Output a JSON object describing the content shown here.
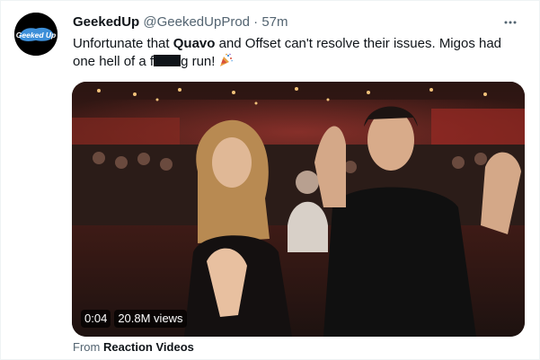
{
  "tweet": {
    "display_name": "GeekedUp",
    "handle": "@GeekedUpProd",
    "separator": "·",
    "time": "57m",
    "text_part1": "Unfortunate that ",
    "text_bold": "Quavo",
    "text_part2": " and Offset can't resolve their issues. Migos had one hell of a f",
    "text_part3": "g run!",
    "emoji": "party-popper"
  },
  "avatar": {
    "logo_text": "Geeked Up",
    "colors": {
      "background": "#000000",
      "logo": "#3d8fd9"
    }
  },
  "video": {
    "timestamp": "0:04",
    "views": "20.8M views"
  },
  "source": {
    "prefix": "From",
    "name": "Reaction Videos"
  },
  "icons": {
    "more": "more-options-icon"
  }
}
